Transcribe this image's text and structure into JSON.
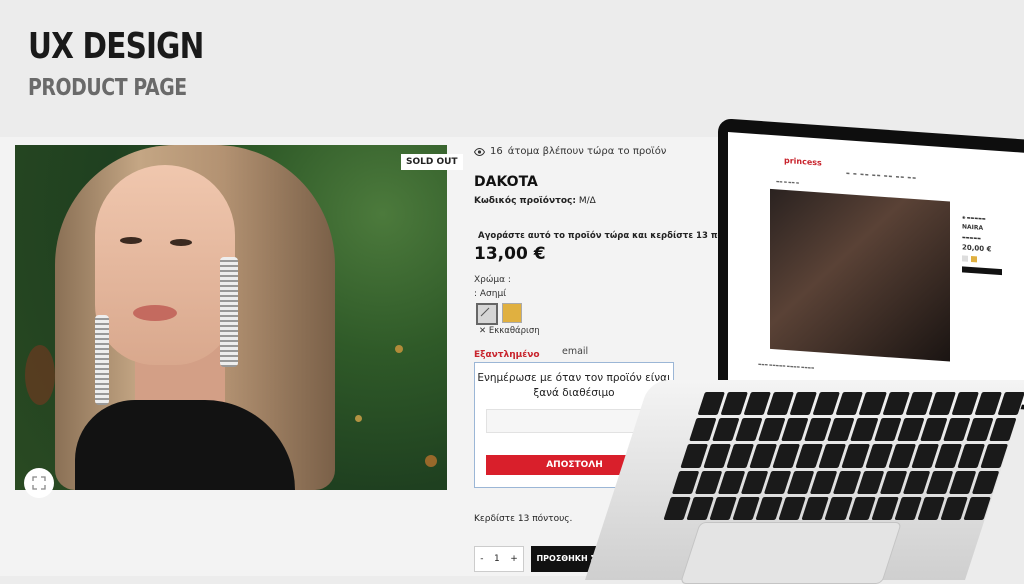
{
  "headline": {
    "title": "UX DESIGN",
    "subtitle": "PRODUCT PAGE"
  },
  "product": {
    "badge": "SOLD OUT",
    "viewers_count": "16",
    "viewers_text": "άτομα βλέπουν τώρα το προϊόν",
    "name": "DAKOTA",
    "sku_label": "Κωδικός προϊόντος:",
    "sku_value": "Μ/Δ",
    "points_promo": "Αγοράστε αυτό το προϊόν τώρα και κερδίστε 13 πόντους!",
    "price": "13,00 €",
    "color_label": "Χρώμα :",
    "color_value": ": Ασημί",
    "clear_label": "Εκκαθάριση",
    "stock_status": "Εξαντλημένο",
    "earn_points": "Κερδίστε 13 πόντους.",
    "colors": {
      "accent_red": "#d91f2b",
      "silver": "#d6d6d6",
      "gold": "#e0b040"
    }
  },
  "notify": {
    "email_label": "email",
    "title": "Ενημέρωσε με όταν τον προϊόν είναι ξανά διαθέσιμο",
    "input_placeholder": "",
    "button_label": "ΑΠΟΣΤΟΛΗ"
  },
  "cart": {
    "minus": "-",
    "quantity": "1",
    "plus": "+",
    "add_label": "ΠΡΟΣΘΗΚΗ ΣΤΟ ΚΑΛΑΘΙ"
  },
  "laptop": {
    "logo": "princess",
    "product_name": "NAIRA",
    "price": "20,00 €"
  }
}
